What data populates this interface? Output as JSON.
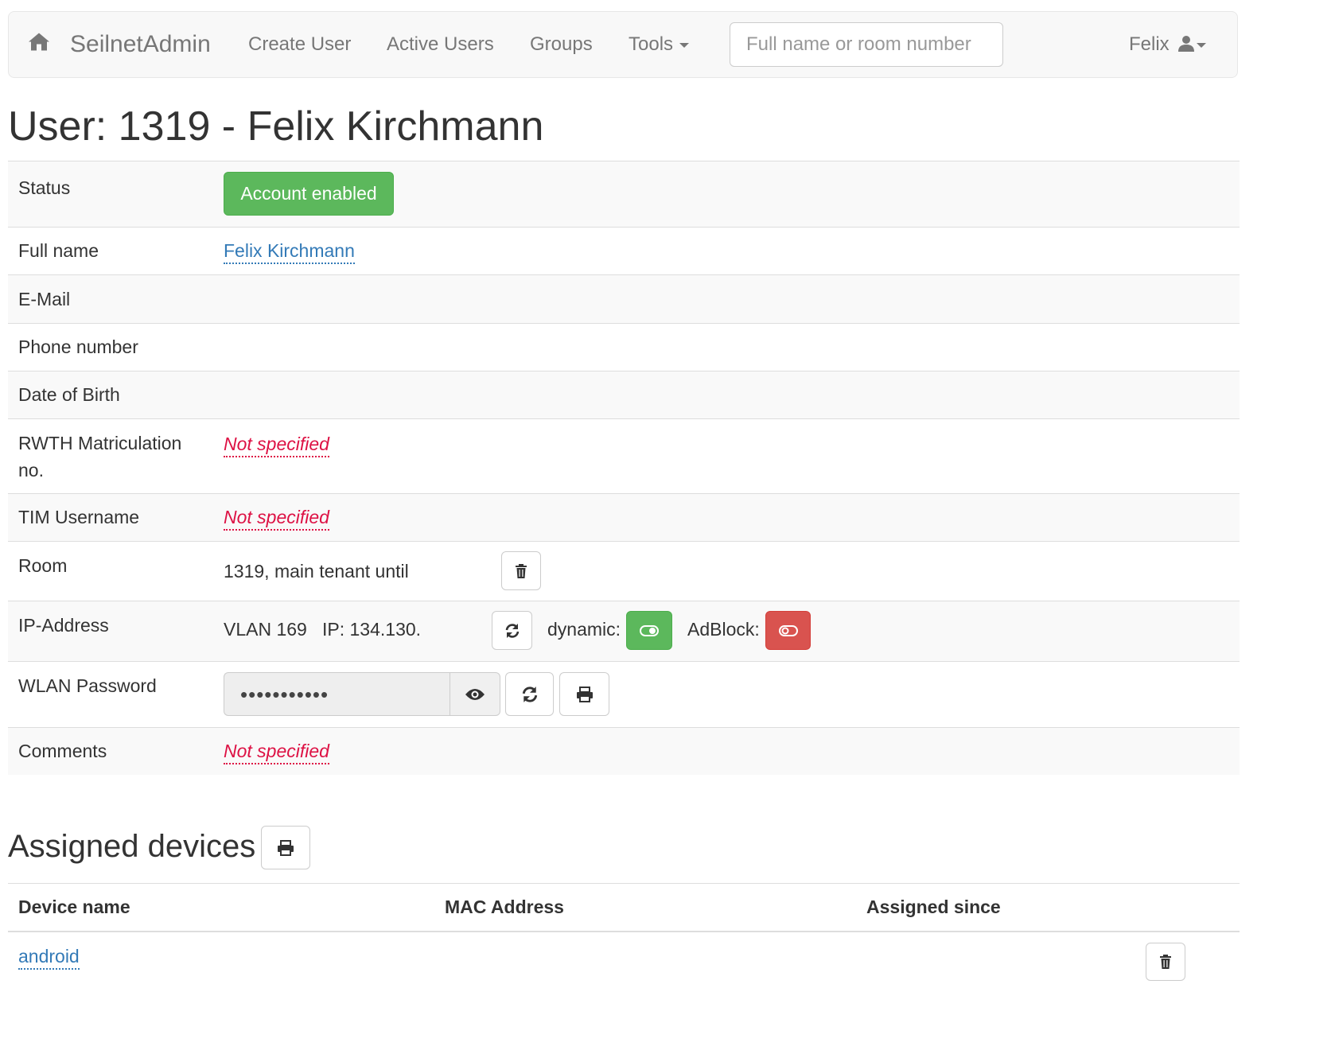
{
  "navbar": {
    "brand": "SeilnetAdmin",
    "links": [
      "Create User",
      "Active Users",
      "Groups",
      "Tools"
    ],
    "search_placeholder": "Full name or room number",
    "user": "Felix"
  },
  "page_title": "User: 1319 - Felix Kirchmann",
  "details": {
    "status_label": "Status",
    "status_value": "Account enabled",
    "fullname_label": "Full name",
    "fullname_value": "Felix Kirchmann",
    "email_label": "E-Mail",
    "phone_label": "Phone number",
    "dob_label": "Date of Birth",
    "matric_label": "RWTH Matriculation no.",
    "matric_value": "Not specified",
    "tim_label": "TIM Username",
    "tim_value": "Not specified",
    "room_label": "Room",
    "room_value": "1319, main tenant until",
    "ip_label": "IP-Address",
    "vlan_value": "VLAN 169",
    "ip_value": "IP: 134.130.",
    "dynamic_label": "dynamic:",
    "dynamic_state": "on",
    "adblock_label": "AdBlock:",
    "adblock_state": "off",
    "wlan_label": "WLAN Password",
    "wlan_value": "•••••••••••",
    "comments_label": "Comments",
    "comments_value": "Not specified"
  },
  "devices": {
    "title": "Assigned devices",
    "columns": [
      "Device name",
      "MAC Address",
      "Assigned since"
    ],
    "rows": [
      {
        "name": "android"
      }
    ]
  },
  "colors": {
    "success": "#5cb85c",
    "danger": "#d9534f",
    "link": "#337ab7",
    "not_specified": "#dd1144"
  }
}
